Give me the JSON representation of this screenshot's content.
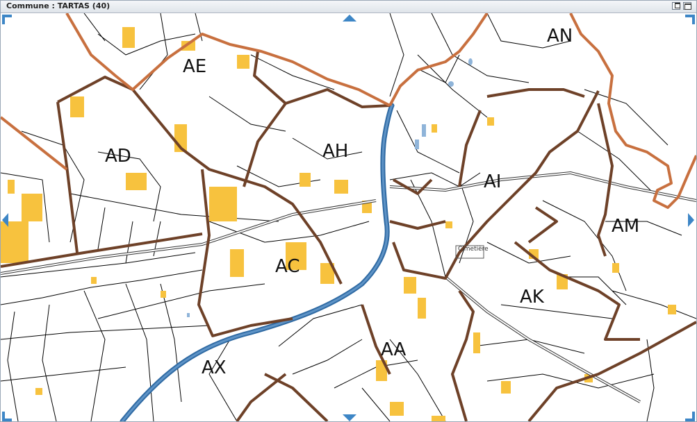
{
  "window": {
    "title": "Commune : TARTAS (40)"
  },
  "map": {
    "section_labels": [
      "AE",
      "AD",
      "AH",
      "AC",
      "AA",
      "AX",
      "AI",
      "AK",
      "AM",
      "AN"
    ],
    "place_labels": [
      "Cimetière"
    ],
    "colors": {
      "commune_boundary": "#c8703f",
      "section_boundary": "#6e4128",
      "river": "#2f6aa3",
      "buildings": "#f7c23e",
      "parcels": "#000000",
      "nav_controls": "#3d86c6"
    }
  },
  "controls": {
    "restore_icon": "restore-icon",
    "maximize_icon": "maximize-icon"
  }
}
